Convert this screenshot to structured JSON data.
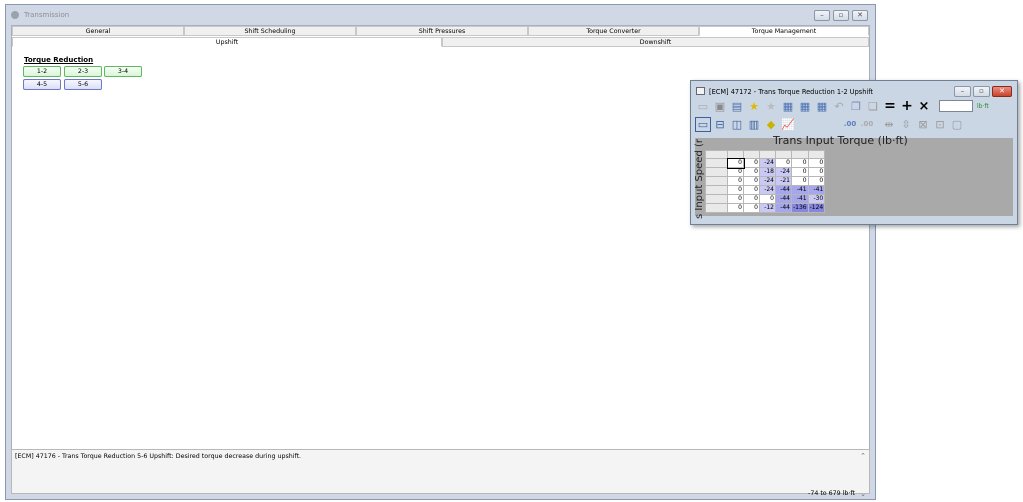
{
  "main": {
    "title": "Transmission",
    "tabs": [
      "General",
      "Shift Scheduling",
      "Shift Pressures",
      "Torque Converter",
      "Torque Management"
    ],
    "active_tab": "Torque Management",
    "subtabs": [
      "Upshift",
      "Downshift"
    ],
    "active_subtab": "Upshift",
    "section_heading": "Torque Reduction",
    "green_buttons": [
      "1-2",
      "2-3",
      "3-4"
    ],
    "blue_buttons": [
      "4-5",
      "5-6"
    ]
  },
  "status": {
    "description": "[ECM] 47176 - Trans Torque Reduction 5-6 Upshift: Desired torque decrease during upshift.",
    "range": "-74 to 679 lb·ft"
  },
  "table_window": {
    "title": "[ECM] 47172 - Trans Torque Reduction 1-2 Upshift",
    "unit": "lb·ft",
    "value_input": "",
    "table_title": "Trans Input Torque (lb·ft)",
    "y_axis_label": "s Input Speed (r",
    "toolbar_symbols": {
      "equals": "=",
      "plus": "+",
      "times": "×",
      "decimal_up": ".00",
      "decimal_down": ".00"
    },
    "rows": [
      [
        "0",
        "0",
        "-24",
        "0",
        "0",
        "0"
      ],
      [
        "0",
        "0",
        "-18",
        "-24",
        "0",
        "0"
      ],
      [
        "0",
        "0",
        "-24",
        "-21",
        "0",
        "0"
      ],
      [
        "0",
        "0",
        "-24",
        "-44",
        "-41",
        "-41"
      ],
      [
        "0",
        "0",
        "0",
        "-44",
        "-41",
        "-30"
      ],
      [
        "0",
        "0",
        "-12",
        "-44",
        "-136",
        "-124"
      ]
    ]
  },
  "colors": {
    "window_frame": "#cfd8e4",
    "shade_light": "#c9c9f4",
    "shade_mid": "#a6a6ec",
    "shade_dark": "#8686e0",
    "unit_green": "#2b8a2b"
  }
}
